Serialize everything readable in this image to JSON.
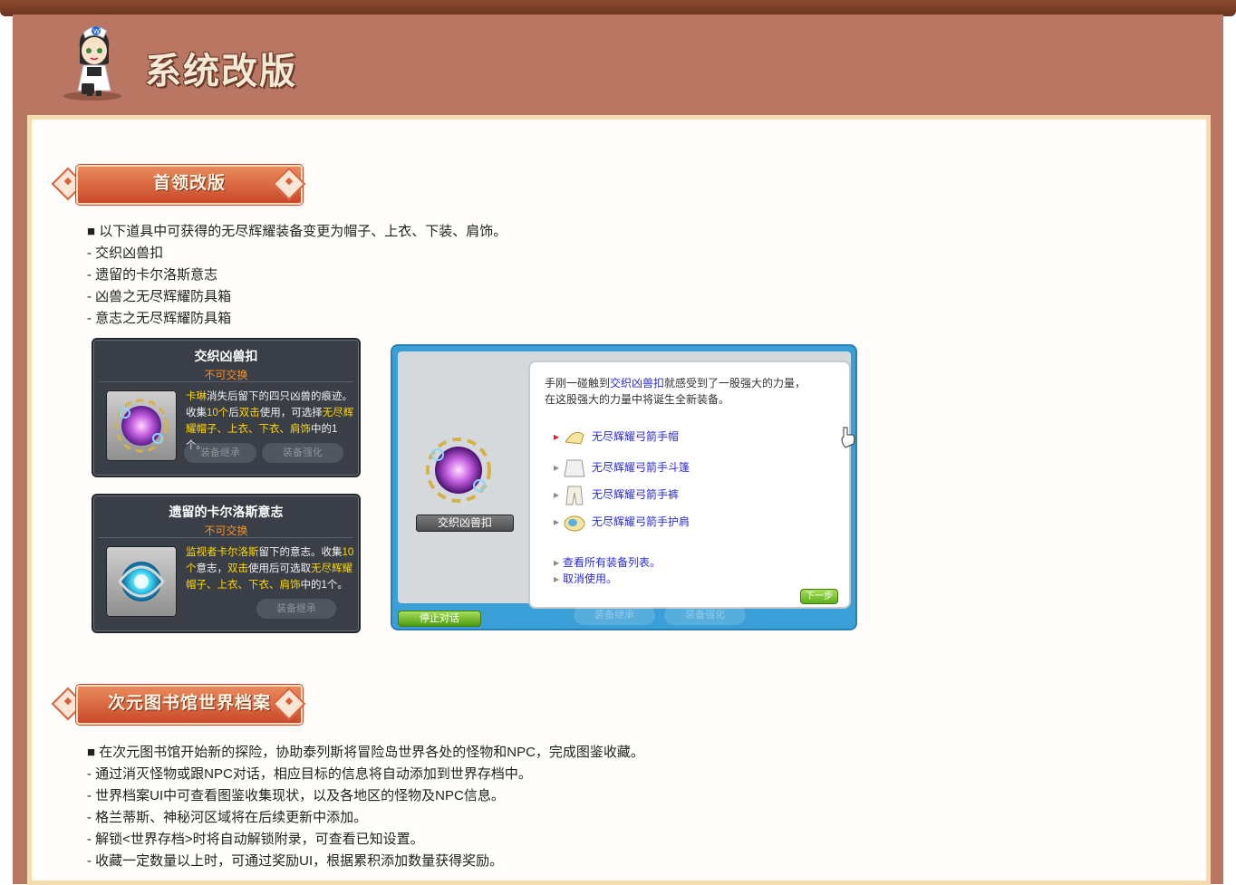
{
  "header": {
    "title": "系统改版"
  },
  "section1": {
    "banner": "首领改版",
    "lines": [
      "■ 以下道具中可获得的无尽辉耀装备变更为帽子、上衣、下装、肩饰。",
      "- 交织凶兽扣",
      "- 遗留的卡尔洛斯意志",
      "- 凶兽之无尽辉耀防具箱",
      "- 意志之无尽辉耀防具箱"
    ]
  },
  "tooltip1": {
    "name": "交织凶兽扣",
    "tradable": "不可交换",
    "desc": [
      {
        "t": "卡琳",
        "hl": true
      },
      {
        "t": "消失后留下的四只凶兽的痕迹。收集",
        "hl": false
      },
      {
        "t": "10个",
        "hl": true
      },
      {
        "t": "后",
        "hl": false
      },
      {
        "t": "双击",
        "hl": true
      },
      {
        "t": "使用，可选择",
        "hl": false
      },
      {
        "t": "无尽辉耀帽子、上衣、下衣、肩饰",
        "hl": true
      },
      {
        "t": "中的1个。",
        "hl": false
      }
    ],
    "ghost_buttons": [
      "装备继承",
      "装备强化"
    ]
  },
  "tooltip2": {
    "name": "遗留的卡尔洛斯意志",
    "tradable": "不可交换",
    "desc": [
      {
        "t": "监视者卡尔洛斯",
        "hl": true
      },
      {
        "t": "留下的意志。收集",
        "hl": false
      },
      {
        "t": "10个",
        "hl": true
      },
      {
        "t": "意志，",
        "hl": false
      },
      {
        "t": "双击",
        "hl": true
      },
      {
        "t": "使用后可选取",
        "hl": false
      },
      {
        "t": "无尽辉耀帽子、上衣、下衣、肩饰",
        "hl": true
      },
      {
        "t": "中的1个。",
        "hl": false
      }
    ],
    "ghost_buttons": [
      "装备继承",
      "装备强化"
    ]
  },
  "npc_dialog": {
    "item_name": "交织凶兽扣",
    "intro_before": "手刚一碰触到",
    "intro_link": "交织凶兽扣",
    "intro_after": "就感受到了一股强大的力量，",
    "intro_line2": "在这股强大的力量中将诞生全新装备。",
    "options": [
      "无尽辉耀弓箭手帽",
      "无尽辉耀弓箭手斗篷",
      "无尽辉耀弓箭手裤",
      "无尽辉耀弓箭手护肩"
    ],
    "view_all": "查看所有装备列表。",
    "cancel": "取消使用。",
    "next_label": "下一步",
    "stop_label": "停止对话",
    "ghost_buttons": [
      "装备继承",
      "装备强化"
    ]
  },
  "section2": {
    "banner": "次元图书馆世界档案",
    "lines": [
      "■ 在次元图书馆开始新的探险，协助泰列斯将冒险岛世界各处的怪物和NPC，完成图鉴收藏。",
      "- 通过消灭怪物或跟NPC对话，相应目标的信息将自动添加到世界存档中。",
      "- 世界档案UI中可查看图鉴收集现状，以及各地区的怪物及NPC信息。",
      "- 格兰蒂斯、神秘河区域将在后续更新中添加。",
      "- 解锁<世界存档>时将自动解锁附录，可查看已知设置。",
      "- 收藏一定数量以上时，可通过奖励UI，根据累积添加数量获得奖励。"
    ]
  }
}
